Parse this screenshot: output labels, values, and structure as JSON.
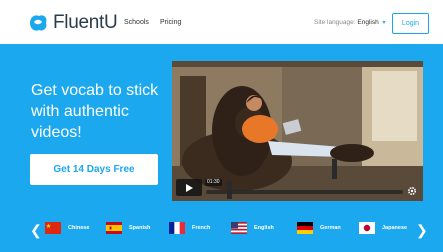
{
  "header": {
    "brand": "FluentU",
    "nav": [
      "Schools",
      "Pricing"
    ],
    "site_language_label": "Site language:",
    "site_language_value": "English",
    "login_label": "Login"
  },
  "hero": {
    "headline": "Get vocab to stick with authentic videos!",
    "cta_label": "Get 14 Days Free"
  },
  "video": {
    "timestamp": "01:30"
  },
  "languages": [
    {
      "name": "Chinese",
      "flag": "china-flag"
    },
    {
      "name": "Spanish",
      "flag": "spain-flag"
    },
    {
      "name": "French",
      "flag": "france-flag"
    },
    {
      "name": "English",
      "flag": "usa-flag"
    },
    {
      "name": "German",
      "flag": "germany-flag"
    },
    {
      "name": "Japanese",
      "flag": "japan-flag"
    }
  ],
  "colors": {
    "brand_blue": "#1ba8ee",
    "white": "#ffffff"
  }
}
